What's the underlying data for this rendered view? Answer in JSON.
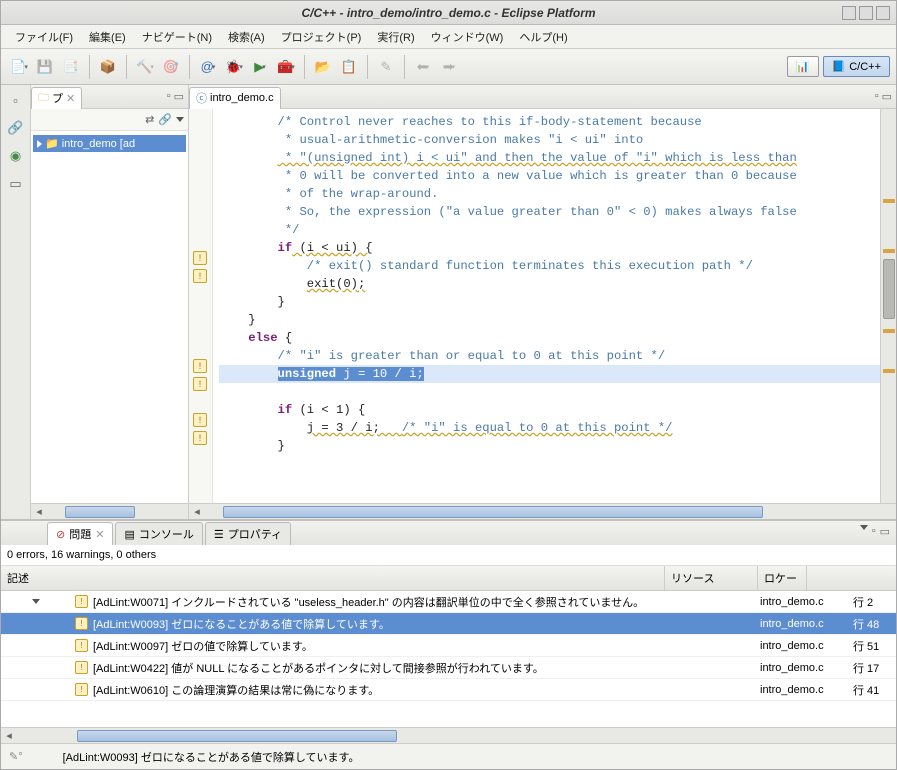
{
  "window": {
    "title": "C/C++ - intro_demo/intro_demo.c - Eclipse Platform"
  },
  "menus": [
    "ファイル(F)",
    "編集(E)",
    "ナビゲート(N)",
    "検索(A)",
    "プロジェクト(P)",
    "実行(R)",
    "ウィンドウ(W)",
    "ヘルプ(H)"
  ],
  "perspective": {
    "label": "C/C++"
  },
  "projectView": {
    "tab": "プ",
    "item": "intro_demo [ad"
  },
  "editor": {
    "tab": "intro_demo.c"
  },
  "code": {
    "c1": "/* Control never reaches to this if-body-statement because",
    "c2": " * usual-arithmetic-conversion makes \"i < ui\" into",
    "c3": " * \"(unsigned int) i < ui\" and then the value of \"i\" which is less than",
    "c4": " * 0 will be converted into a new value which is greater than 0 because",
    "c5": " * of the wrap-around.",
    "c6": " * So, the expression (\"a value greater than 0\" < 0) makes always false",
    "c7": " */",
    "l1a": "if",
    "l1b": " (i < ui) {",
    "c8": "/* exit() standard function terminates this execution path */",
    "l2": "exit(0);",
    "l3": "}",
    "l4": "}",
    "l5a": "else",
    "l5b": " {",
    "c9": "/* \"i\" is greater than or equal to 0 at this point */",
    "sel_a": "unsigned",
    "sel_b": " j = 10 / i;",
    "l6a": "if",
    "l6b": " (i < 1) {",
    "l7a": "j = 3 / i;   ",
    "c10": "/* \"i\" is equal to 0 at this point */",
    "l8": "}"
  },
  "problems": {
    "tabs": [
      "問題",
      "コンソール",
      "プロパティ"
    ],
    "summary": "0 errors, 16 warnings, 0 others",
    "columns": {
      "desc": "記述",
      "res": "リソース",
      "loc": "ロケー"
    },
    "closeX": "✕",
    "rows": [
      {
        "desc": "[AdLint:W0071] インクルードされている \"useless_header.h\" の内容は翻訳単位の中で全く参照されていません。",
        "res": "intro_demo.c",
        "loc": "行 2"
      },
      {
        "desc": "[AdLint:W0093] ゼロになることがある値で除算しています。",
        "res": "intro_demo.c",
        "loc": "行 48"
      },
      {
        "desc": "[AdLint:W0097] ゼロの値で除算しています。",
        "res": "intro_demo.c",
        "loc": "行 51"
      },
      {
        "desc": "[AdLint:W0422] 値が NULL になることがあるポインタに対して間接参照が行われています。",
        "res": "intro_demo.c",
        "loc": "行 17"
      },
      {
        "desc": "[AdLint:W0610] この論理演算の結果は常に偽になります。",
        "res": "intro_demo.c",
        "loc": "行 41"
      }
    ]
  },
  "status": {
    "text": "[AdLint:W0093] ゼロになることがある値で除算しています。"
  }
}
